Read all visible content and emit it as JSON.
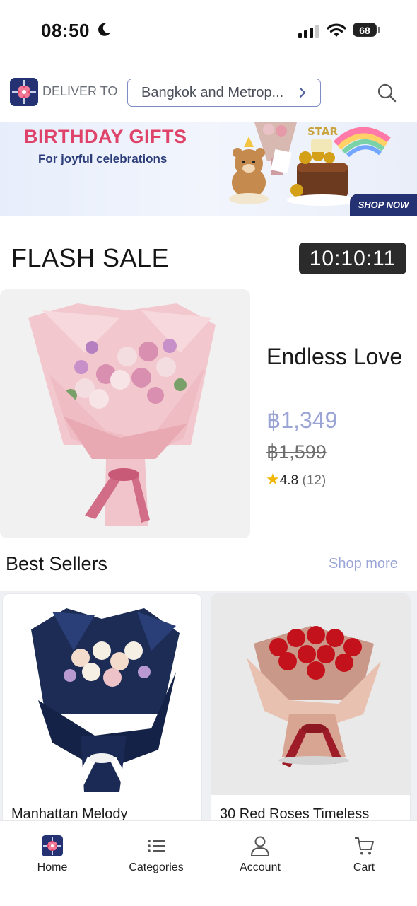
{
  "status_bar": {
    "time": "08:50",
    "battery": "68"
  },
  "header": {
    "deliver_label": "DELIVER TO",
    "location": "Bangkok and Metrop...",
    "brand_color": "#243173"
  },
  "banner": {
    "title": "BIRTHDAY GIFTS",
    "subtitle": "For joyful celebrations",
    "cta": "SHOP NOW"
  },
  "flash_sale": {
    "title": "FLASH SALE",
    "timer": "10:10:11",
    "product": {
      "name": "Endless Love",
      "price": "฿1,349",
      "old_price": "฿1,599",
      "rating": "4.8",
      "reviews": "(12)"
    }
  },
  "best_sellers": {
    "title": "Best Sellers",
    "more_label": "Shop more",
    "products": [
      {
        "name": "Manhattan Melody"
      },
      {
        "name": "30 Red Roses Timeless"
      }
    ]
  },
  "bottom_nav": {
    "items": [
      {
        "label": "Home",
        "icon": "home-logo-icon"
      },
      {
        "label": "Categories",
        "icon": "list-icon"
      },
      {
        "label": "Account",
        "icon": "person-icon"
      },
      {
        "label": "Cart",
        "icon": "cart-icon"
      }
    ]
  }
}
